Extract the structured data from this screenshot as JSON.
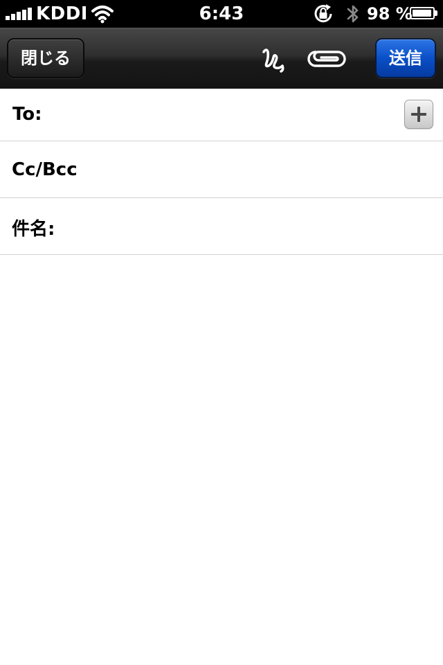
{
  "status_bar": {
    "carrier": "KDDI",
    "time": "6:43",
    "battery_text": "98 %",
    "battery_level": 0.98,
    "signal_icon": "signal-bars-icon",
    "wifi_icon": "wifi-icon",
    "orientation_lock_icon": "orientation-lock-icon",
    "bluetooth_icon": "bluetooth-icon",
    "battery_icon": "battery-icon"
  },
  "toolbar": {
    "close_label": "閉じる",
    "send_label": "送信",
    "signature_icon": "signature-icon",
    "attachment_icon": "paperclip-icon",
    "send_color": "#0a4fc7"
  },
  "compose": {
    "to_label": "To:",
    "to_value": "",
    "cc_bcc_label": "Cc/Bcc",
    "cc_bcc_value": "",
    "subject_label": "件名:",
    "subject_value": "",
    "add_contact_icon": "plus-icon",
    "body_value": ""
  }
}
